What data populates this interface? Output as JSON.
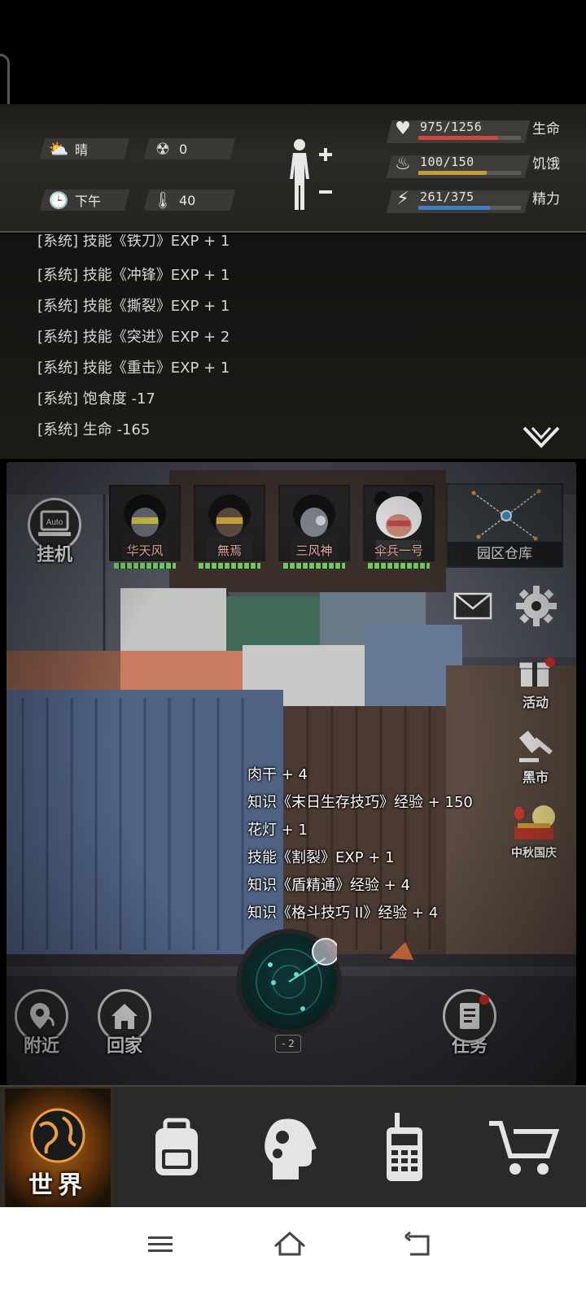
{
  "status": {
    "weather": "晴",
    "radiation": "0",
    "time_of_day": "下午",
    "temperature": "40",
    "stats": [
      {
        "label": "生命",
        "value_text": "975/1256",
        "current": 975,
        "max": 1256,
        "color": "#c84a43",
        "icon": "heart-icon"
      },
      {
        "label": "饥饿",
        "value_text": "100/150",
        "current": 100,
        "max": 150,
        "color": "#c99a3a",
        "icon": "hunger-icon"
      },
      {
        "label": "精力",
        "value_text": "261/375",
        "current": 261,
        "max": 375,
        "color": "#3f7fc8",
        "icon": "energy-icon"
      }
    ]
  },
  "log": {
    "lines": [
      "[系统] 技能《铁刀》EXP + 1",
      "[系统] 技能《冲锋》EXP + 1",
      "[系统] 技能《撕裂》EXP + 1",
      "[系统] 技能《突进》EXP + 2",
      "[系统] 技能《重击》EXP + 1",
      "[系统] 饱食度 -17",
      "[系统] 生命 -165"
    ]
  },
  "scene": {
    "auto_badge": "Auto",
    "auto_label": "挂机",
    "heroes": [
      {
        "name": "华天风",
        "hp_fraction": 1.0
      },
      {
        "name": "無焉",
        "hp_fraction": 1.0
      },
      {
        "name": "三风神",
        "hp_fraction": 1.0
      },
      {
        "name": "伞兵一号",
        "hp_fraction": 1.0
      }
    ],
    "map_label": "园区仓库",
    "side": {
      "activity": "活动",
      "black_market": "黑市",
      "festival": "中秋国庆"
    },
    "rewards": [
      "肉干 + 4",
      "知识《末日生存技巧》经验 + 150",
      "花灯 + 1",
      "技能《割裂》EXP + 1",
      "知识《盾精通》经验 + 4",
      "知识《格斗技巧 II》经验 + 4"
    ],
    "radar_zoom": "- 2",
    "nearby": "附近",
    "home": "回家",
    "tasks": "任务"
  },
  "nav": {
    "world": "世界"
  }
}
